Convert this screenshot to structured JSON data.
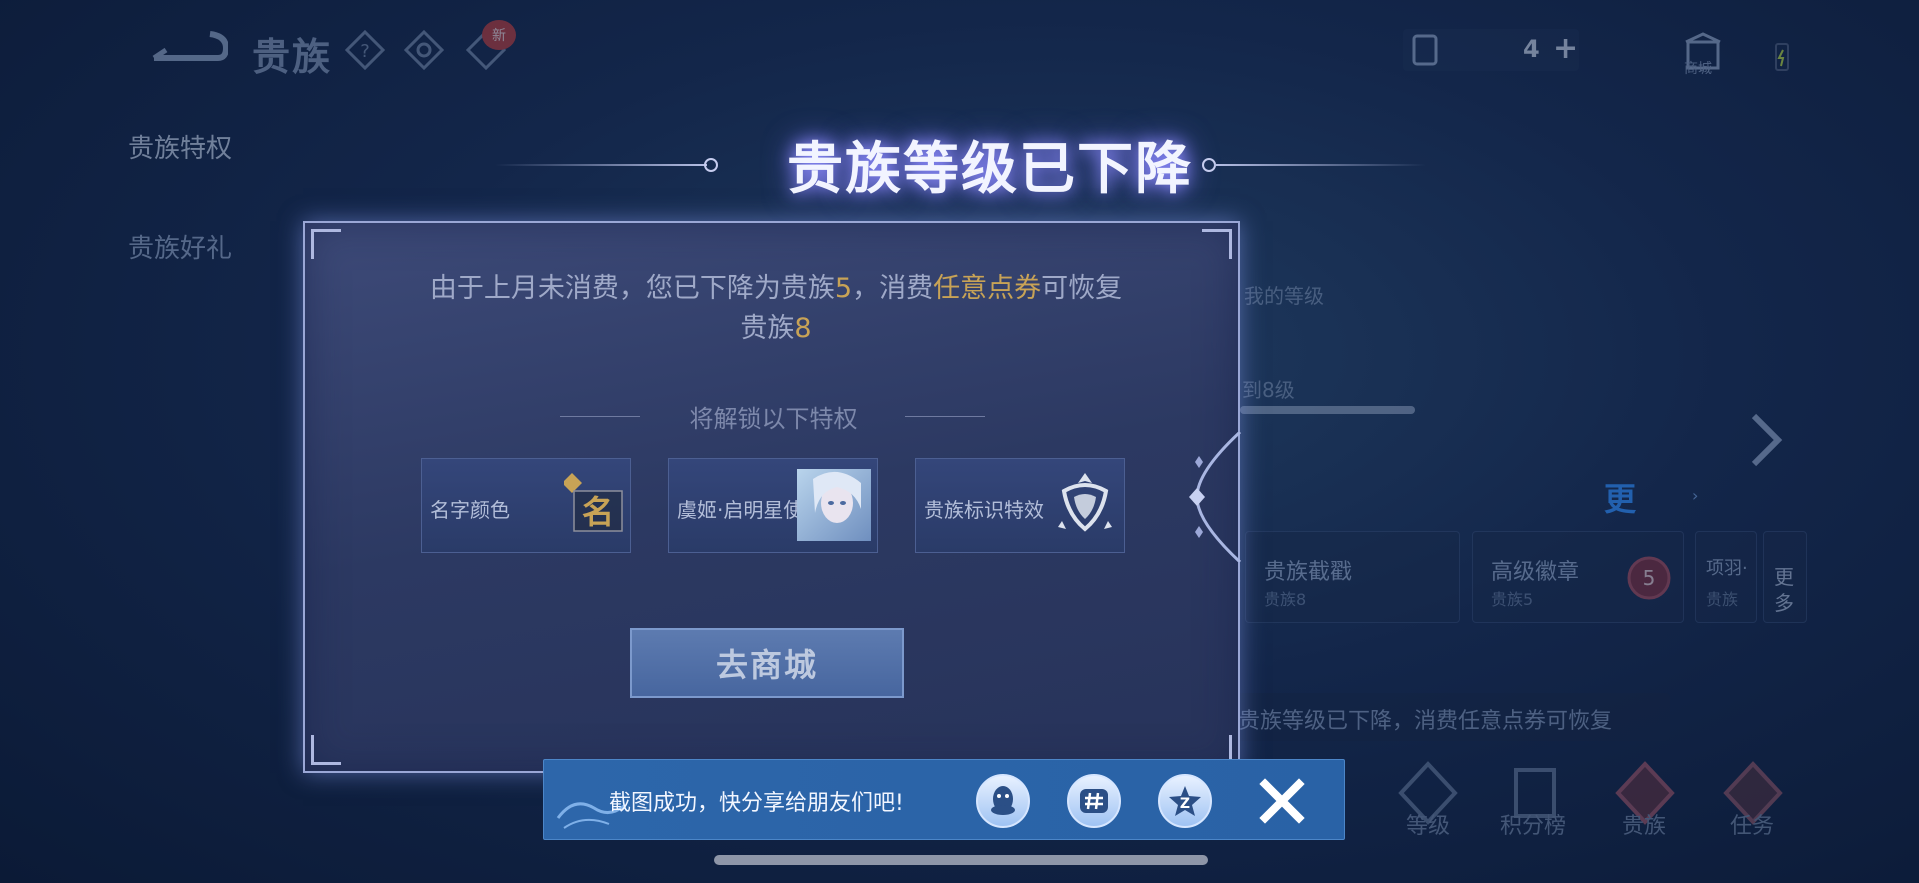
{
  "background": {
    "header_title": "贵族",
    "new_badge": "新",
    "coupon_count": "4",
    "coupon_plus": "+",
    "shop_label": "商城",
    "side_tabs": [
      "贵族特权",
      "贵族好礼"
    ],
    "my_level_label": "我的等级",
    "to_level_label": "到8级",
    "level_progress": 1.0,
    "more_label": "更",
    "cards": [
      {
        "title": "贵族截戳",
        "sub": "贵族8"
      },
      {
        "title": "高级徽章",
        "sub": "贵族5"
      },
      {
        "title": "项羽·",
        "sub": "贵族"
      }
    ],
    "more_card_text": "更多",
    "badge_number": "5",
    "hint": "贵族等级已下降，消费任意点券可恢复",
    "bottom_nav": [
      "等级",
      "积分榜",
      "贵族",
      "任务"
    ]
  },
  "dialog": {
    "title": "贵族等级已下降",
    "message_part1": "由于上月未消费，您已下降为贵族",
    "current_level": "5",
    "message_part2": "，消费",
    "highlight_action": "任意点券",
    "message_part3": "可恢复",
    "message_part4": "贵族",
    "restore_level": "8",
    "unlock_label": "将解锁以下特权",
    "privileges": [
      {
        "label": "名字颜色",
        "icon": "name-color-icon",
        "glyph": "名"
      },
      {
        "label": "虞姬·启明星使",
        "icon": "hero-skin-portrait"
      },
      {
        "label": "贵族标识特效",
        "icon": "noble-emblem-icon"
      }
    ],
    "button_label": "去商城"
  },
  "toast": {
    "text": "截图成功，快分享给朋友们吧!",
    "share_targets": [
      "qq-icon",
      "wechat-moments-icon",
      "qzone-icon"
    ],
    "qzone_glyph": "Z",
    "close_icon": "close-icon"
  },
  "colors": {
    "accent_gold": "#c8a356",
    "toast_blue": "#2d66aa",
    "title_glow": "#8e8dff"
  }
}
